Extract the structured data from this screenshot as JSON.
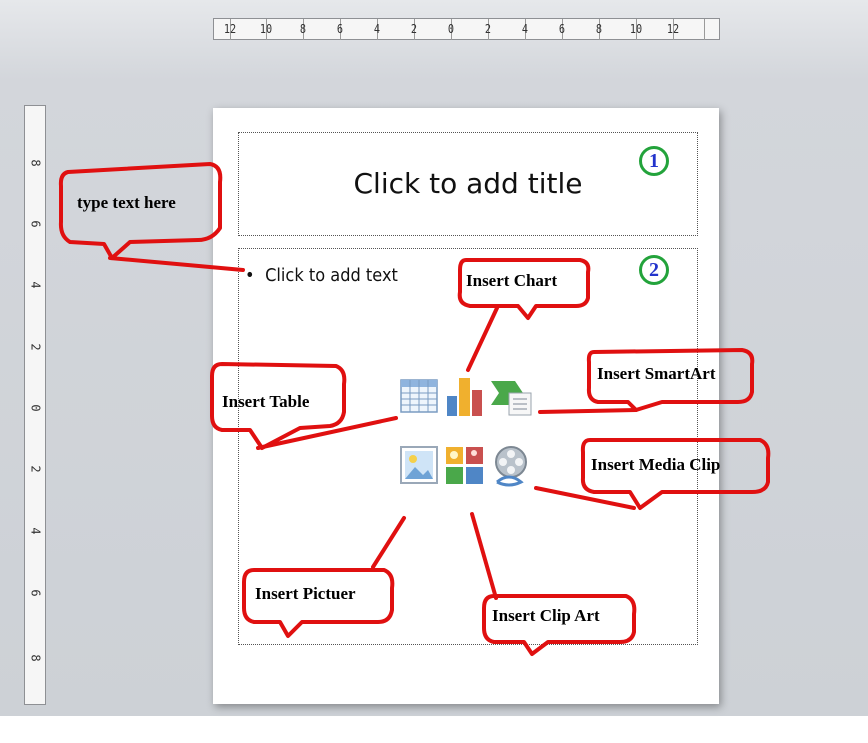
{
  "horizontal_ruler": {
    "ticks": [
      "12",
      "10",
      "8",
      "6",
      "4",
      "2",
      "0",
      "2",
      "4",
      "6",
      "8",
      "10",
      "12"
    ]
  },
  "vertical_ruler": {
    "ticks": [
      "8",
      "6",
      "4",
      "2",
      "0",
      "2",
      "4",
      "6",
      "8"
    ]
  },
  "slide": {
    "title_placeholder": "Click to add title",
    "content_placeholder": "Click to add text",
    "bullet": "•",
    "marker_1": "1",
    "marker_2": "2"
  },
  "annotations": {
    "type_text": "type text here",
    "insert_chart": "Insert Chart",
    "insert_smartart": "Insert SmartArt",
    "insert_table": "Insert Table",
    "insert_media_clip": "Insert Media Clip",
    "insert_picture": "Insert Pictuer",
    "insert_clip_art": "Insert Clip Art"
  },
  "colors": {
    "annotation_stroke": "#e01010",
    "marker_circle": "#23a33b",
    "marker_digit": "#2233cc"
  },
  "icons": [
    "table-icon",
    "chart-icon",
    "smartart-icon",
    "picture-icon",
    "clip-art-icon",
    "media-clip-icon"
  ]
}
